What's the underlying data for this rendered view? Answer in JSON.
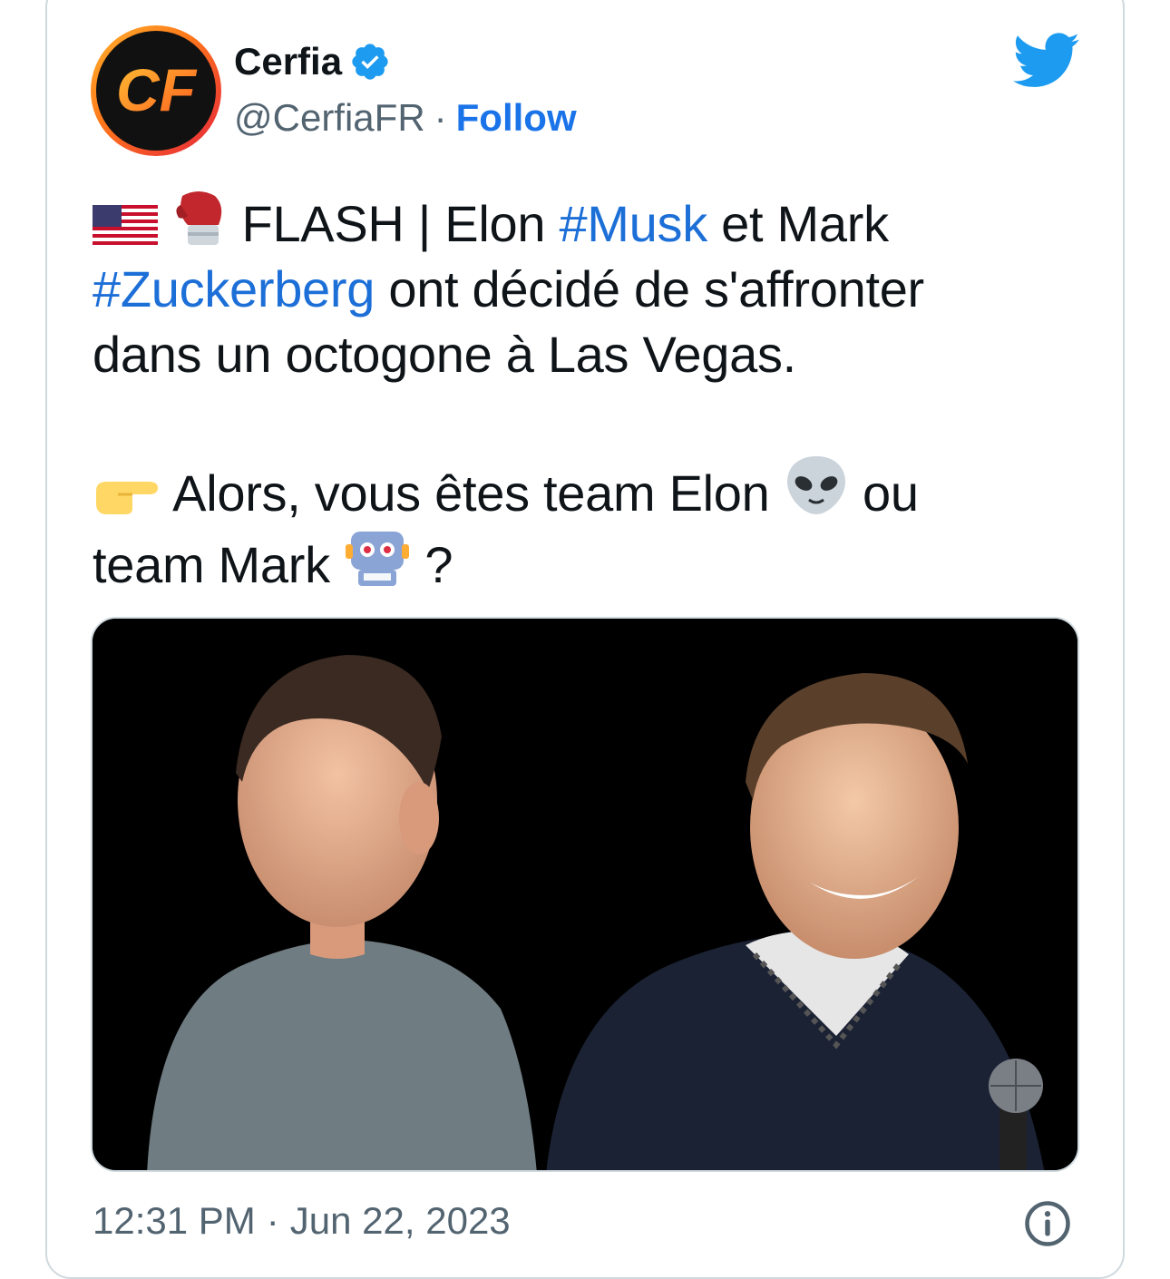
{
  "tweet": {
    "author": {
      "name": "Cerfia",
      "handle": "@CerfiaFR",
      "separator": "·",
      "follow_label": "Follow",
      "logo_text": "CF",
      "verified": true
    },
    "text": {
      "line1_prefix": "FLASH | Elon",
      "hashtag1": "#Musk",
      "line1_suffix": "et Mark",
      "hashtag2": "#Zuckerberg",
      "line2_suffix": "ont décidé de s'affronter",
      "line3": "dans un octogone à Las Vegas.",
      "line4_prefix": "Alors, vous êtes team Elon",
      "line4_suffix": "ou",
      "line5_prefix": "team Mark",
      "line5_suffix": "?"
    },
    "timestamp": {
      "time": "12:31 PM",
      "separator": "·",
      "date": "Jun 22, 2023"
    }
  },
  "icons": {
    "bird": "twitter-bird-icon",
    "verified": "verified-badge-icon",
    "info": "info-icon",
    "flag": "us-flag-emoji",
    "glove": "boxing-glove-emoji",
    "pointing": "pointing-right-emoji",
    "alien": "alien-emoji",
    "robot": "robot-emoji"
  },
  "colors": {
    "link": "#1d6fd8",
    "follow": "#1a73e8",
    "secondary_text": "#536471",
    "border": "#cfd9de",
    "twitter_blue": "#1d9bf0"
  }
}
